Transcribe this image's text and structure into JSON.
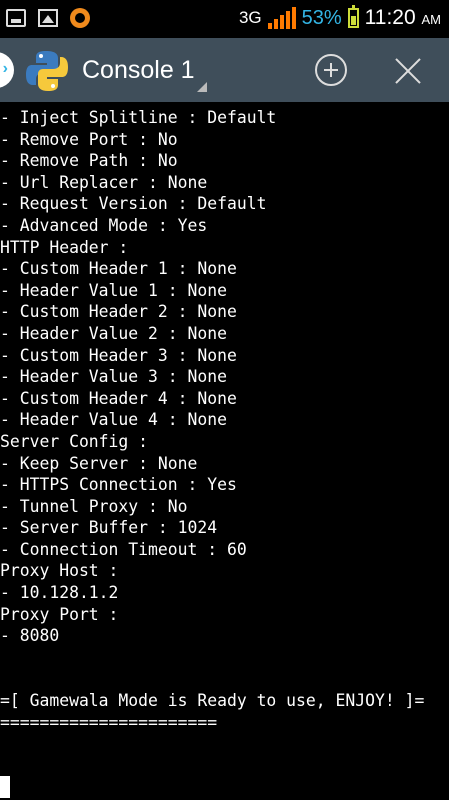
{
  "status_bar": {
    "network": "3G",
    "battery_percent": "53%",
    "time": "11:20",
    "ampm": "AM",
    "icons": [
      "screenshot-icon",
      "gallery-icon",
      "app-notification-icon",
      "signal-icon",
      "battery-icon"
    ]
  },
  "action_bar": {
    "title": "Console 1",
    "add_icon": "plus-circle-icon",
    "close_icon": "close-icon"
  },
  "console": {
    "lines": [
      "- Inject Splitline : Default",
      "- Remove Port : No",
      "- Remove Path : No",
      "- Url Replacer : None",
      "- Request Version : Default",
      "- Advanced Mode : Yes",
      "HTTP Header :",
      "- Custom Header 1 : None",
      "- Header Value 1 : None",
      "- Custom Header 2 : None",
      "- Header Value 2 : None",
      "- Custom Header 3 : None",
      "- Header Value 3 : None",
      "- Custom Header 4 : None",
      "- Header Value 4 : None",
      "Server Config :",
      "- Keep Server : None",
      "- HTTPS Connection : Yes",
      "- Tunnel Proxy : No",
      "- Server Buffer : 1024",
      "- Connection Timeout : 60",
      "Proxy Host :",
      "- 10.128.1.2",
      "Proxy Port :",
      "- 8080",
      "",
      "",
      "=[ Gamewala Mode is Ready to use, ENJOY! ]=",
      "======================"
    ]
  },
  "colors": {
    "action_bar": "#3f4e5a",
    "battery_text": "#33b5e5",
    "signal": "#ff7a00",
    "battery": "#cddc39",
    "console_bg": "#000000",
    "console_text": "#ffffff"
  }
}
